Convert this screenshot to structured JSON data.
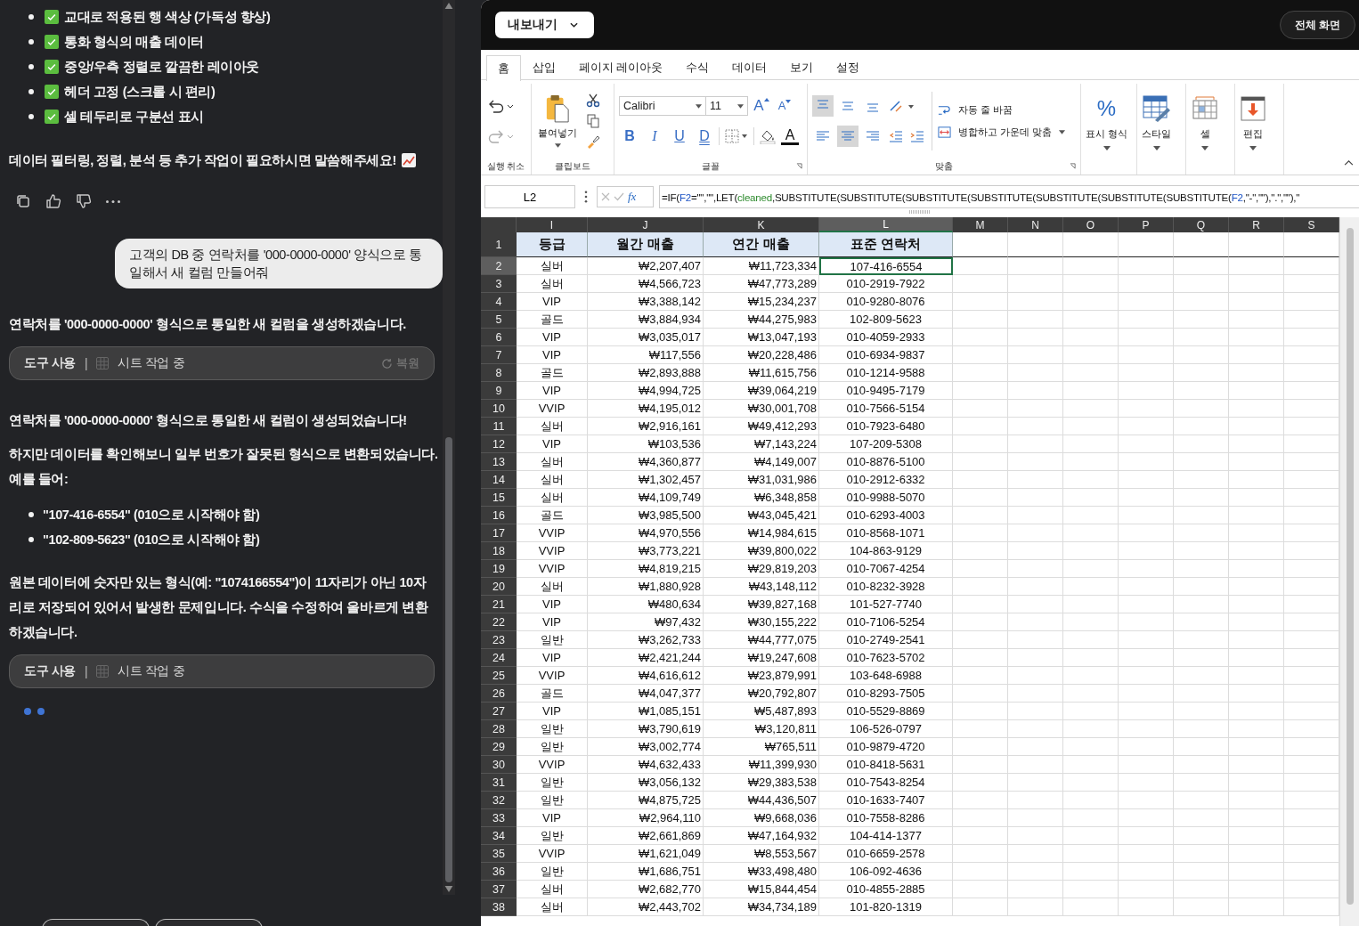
{
  "chat": {
    "checklist": [
      {
        "text": "교대로 적용된 행 색상 (가독성 향상)",
        "checked": true
      },
      {
        "text": "통화 형식의 매출 데이터",
        "checked": true
      },
      {
        "text": "중앙/우측 정렬로 깔끔한 레이아웃",
        "checked": true
      },
      {
        "text": "헤더 고정 (스크롤 시 편리)",
        "checked": true
      },
      {
        "text": "셀 테두리로 구분선 표시",
        "checked": true
      }
    ],
    "closing": "데이터 필터링, 정렬, 분석 등 추가 작업이 필요하시면 말씀해주세요!",
    "user_message": "고객의 DB 중 연락처를 '000-0000-0000' 양식으로 통일해서 새 컬럼 만들어줘",
    "blocks": [
      {
        "kind": "paragraph",
        "text": "연락처를 '000-0000-0000' 형식으로 통일한 새 컬럼을 생성하겠습니다."
      },
      {
        "kind": "tool",
        "label": "도구 사용",
        "separator": "|",
        "status": "시트 작업 중",
        "restore": "복원"
      },
      {
        "kind": "paragraph",
        "text": "연락처를 '000-0000-0000' 형식으로 통일한 새 컬럼이 생성되었습니다!"
      },
      {
        "kind": "paragraph",
        "text": "하지만 데이터를 확인해보니 일부 번호가 잘못된 형식으로 변환되었습니다. 예를 들어:"
      },
      {
        "kind": "bullets",
        "items": [
          "\"107-416-6554\" (010으로 시작해야 함)",
          "\"102-809-5623\" (010으로 시작해야 함)"
        ]
      },
      {
        "kind": "paragraph",
        "text": "원본 데이터에 숫자만 있는 형식(예: \"1074166554\")이 11자리가 아닌 10자리로 저장되어 있어서 발생한 문제입니다. 수식을 수정하여 올바르게 변환하겠습니다."
      },
      {
        "kind": "tool",
        "label": "도구 사용",
        "separator": "|",
        "status": "시트 작업 중"
      },
      {
        "kind": "loading"
      }
    ]
  },
  "topbar": {
    "export": "내보내기",
    "fullscreen": "전체 화면"
  },
  "ribbon": {
    "tabs": [
      {
        "label": "홈",
        "selected": true
      },
      {
        "label": "삽입",
        "selected": false
      },
      {
        "label": "페이지 레이아웃",
        "selected": false
      },
      {
        "label": "수식",
        "selected": false
      },
      {
        "label": "데이터",
        "selected": false
      },
      {
        "label": "보기",
        "selected": false
      },
      {
        "label": "설정",
        "selected": false
      }
    ],
    "groups": [
      {
        "kind": "undo",
        "label": "실행 취소"
      },
      {
        "kind": "clipboard",
        "label": "클립보드",
        "paste": "붙여넣기"
      },
      {
        "kind": "font",
        "label": "글꼴",
        "font": "Calibri",
        "size": "11",
        "grow": "A",
        "shrink": "A",
        "styles": [
          "B",
          "I",
          "U",
          "D"
        ],
        "font_color": "A"
      },
      {
        "kind": "alignment",
        "label": "맞춤",
        "vertical": [
          {
            "selected": true
          },
          {
            "selected": false
          },
          {
            "selected": false
          }
        ],
        "horizontal": [
          {
            "selected": false
          },
          {
            "selected": true
          },
          {
            "selected": false
          }
        ],
        "wrap": "자동 줄 바꿈",
        "merge": "병합하고 가운데 맞춤"
      },
      {
        "kind": "number_format",
        "label": "표시 형식",
        "glyph": "%"
      },
      {
        "kind": "styles",
        "label": "스타일"
      },
      {
        "kind": "cells",
        "label": "셀"
      },
      {
        "kind": "editing",
        "label": "편집"
      }
    ]
  },
  "formula_bar": {
    "name_box": "L2",
    "fx": "fx",
    "formula": [
      {
        "kind": "text",
        "text": "=IF("
      },
      {
        "kind": "ref",
        "text": "F2"
      },
      {
        "kind": "text",
        "text": "=\"\",\"\",LET("
      },
      {
        "kind": "name",
        "text": "cleaned"
      },
      {
        "kind": "text",
        "text": ",SUBSTITUTE(SUBSTITUTE(SUBSTITUTE(SUBSTITUTE(SUBSTITUTE(SUBSTITUTE(SUBSTITUTE("
      },
      {
        "kind": "ref",
        "text": "F2"
      },
      {
        "kind": "text",
        "text": ",\"-\",\"\"),\".\",\"\"),\""
      }
    ]
  },
  "sheet": {
    "columns": [
      {
        "letter": "I",
        "selected": false
      },
      {
        "letter": "J",
        "selected": false
      },
      {
        "letter": "K",
        "selected": false
      },
      {
        "letter": "L",
        "selected": true
      },
      {
        "letter": "M",
        "selected": false
      },
      {
        "letter": "N",
        "selected": false
      },
      {
        "letter": "O",
        "selected": false
      },
      {
        "letter": "P",
        "selected": false
      },
      {
        "letter": "Q",
        "selected": false
      },
      {
        "letter": "R",
        "selected": false
      },
      {
        "letter": "S",
        "selected": false
      }
    ],
    "header_row": {
      "number": "1",
      "cells": [
        "등급",
        "월간 매출",
        "연간 매출",
        "표준 연락처"
      ]
    },
    "rows": [
      {
        "number": "2",
        "selected": true,
        "cells": [
          "실버",
          "₩2,207,407",
          "₩11,723,334",
          "107-416-6554"
        ]
      },
      {
        "number": "3",
        "selected": false,
        "cells": [
          "실버",
          "₩4,566,723",
          "₩47,773,289",
          "010-2919-7922"
        ]
      },
      {
        "number": "4",
        "selected": false,
        "cells": [
          "VIP",
          "₩3,388,142",
          "₩15,234,237",
          "010-9280-8076"
        ]
      },
      {
        "number": "5",
        "selected": false,
        "cells": [
          "골드",
          "₩3,884,934",
          "₩44,275,983",
          "102-809-5623"
        ]
      },
      {
        "number": "6",
        "selected": false,
        "cells": [
          "VIP",
          "₩3,035,017",
          "₩13,047,193",
          "010-4059-2933"
        ]
      },
      {
        "number": "7",
        "selected": false,
        "cells": [
          "VIP",
          "₩117,556",
          "₩20,228,486",
          "010-6934-9837"
        ]
      },
      {
        "number": "8",
        "selected": false,
        "cells": [
          "골드",
          "₩2,893,888",
          "₩11,615,756",
          "010-1214-9588"
        ]
      },
      {
        "number": "9",
        "selected": false,
        "cells": [
          "VIP",
          "₩4,994,725",
          "₩39,064,219",
          "010-9495-7179"
        ]
      },
      {
        "number": "10",
        "selected": false,
        "cells": [
          "VVIP",
          "₩4,195,012",
          "₩30,001,708",
          "010-7566-5154"
        ]
      },
      {
        "number": "11",
        "selected": false,
        "cells": [
          "실버",
          "₩2,916,161",
          "₩49,412,293",
          "010-7923-6480"
        ]
      },
      {
        "number": "12",
        "selected": false,
        "cells": [
          "VIP",
          "₩103,536",
          "₩7,143,224",
          "107-209-5308"
        ]
      },
      {
        "number": "13",
        "selected": false,
        "cells": [
          "실버",
          "₩4,360,877",
          "₩4,149,007",
          "010-8876-5100"
        ]
      },
      {
        "number": "14",
        "selected": false,
        "cells": [
          "실버",
          "₩1,302,457",
          "₩31,031,986",
          "010-2912-6332"
        ]
      },
      {
        "number": "15",
        "selected": false,
        "cells": [
          "실버",
          "₩4,109,749",
          "₩6,348,858",
          "010-9988-5070"
        ]
      },
      {
        "number": "16",
        "selected": false,
        "cells": [
          "골드",
          "₩3,985,500",
          "₩43,045,421",
          "010-6293-4003"
        ]
      },
      {
        "number": "17",
        "selected": false,
        "cells": [
          "VVIP",
          "₩4,970,556",
          "₩14,984,615",
          "010-8568-1071"
        ]
      },
      {
        "number": "18",
        "selected": false,
        "cells": [
          "VVIP",
          "₩3,773,221",
          "₩39,800,022",
          "104-863-9129"
        ]
      },
      {
        "number": "19",
        "selected": false,
        "cells": [
          "VVIP",
          "₩4,819,215",
          "₩29,819,203",
          "010-7067-4254"
        ]
      },
      {
        "number": "20",
        "selected": false,
        "cells": [
          "실버",
          "₩1,880,928",
          "₩43,148,112",
          "010-8232-3928"
        ]
      },
      {
        "number": "21",
        "selected": false,
        "cells": [
          "VIP",
          "₩480,634",
          "₩39,827,168",
          "101-527-7740"
        ]
      },
      {
        "number": "22",
        "selected": false,
        "cells": [
          "VIP",
          "₩97,432",
          "₩30,155,222",
          "010-7106-5254"
        ]
      },
      {
        "number": "23",
        "selected": false,
        "cells": [
          "일반",
          "₩3,262,733",
          "₩44,777,075",
          "010-2749-2541"
        ]
      },
      {
        "number": "24",
        "selected": false,
        "cells": [
          "VIP",
          "₩2,421,244",
          "₩19,247,608",
          "010-7623-5702"
        ]
      },
      {
        "number": "25",
        "selected": false,
        "cells": [
          "VVIP",
          "₩4,616,612",
          "₩23,879,991",
          "103-648-6988"
        ]
      },
      {
        "number": "26",
        "selected": false,
        "cells": [
          "골드",
          "₩4,047,377",
          "₩20,792,807",
          "010-8293-7505"
        ]
      },
      {
        "number": "27",
        "selected": false,
        "cells": [
          "VIP",
          "₩1,085,151",
          "₩5,487,893",
          "010-5529-8869"
        ]
      },
      {
        "number": "28",
        "selected": false,
        "cells": [
          "일반",
          "₩3,790,619",
          "₩3,120,811",
          "106-526-0797"
        ]
      },
      {
        "number": "29",
        "selected": false,
        "cells": [
          "일반",
          "₩3,002,774",
          "₩765,511",
          "010-9879-4720"
        ]
      },
      {
        "number": "30",
        "selected": false,
        "cells": [
          "VVIP",
          "₩4,632,433",
          "₩11,399,930",
          "010-8418-5631"
        ]
      },
      {
        "number": "31",
        "selected": false,
        "cells": [
          "일반",
          "₩3,056,132",
          "₩29,383,538",
          "010-7543-8254"
        ]
      },
      {
        "number": "32",
        "selected": false,
        "cells": [
          "일반",
          "₩4,875,725",
          "₩44,436,507",
          "010-1633-7407"
        ]
      },
      {
        "number": "33",
        "selected": false,
        "cells": [
          "VIP",
          "₩2,964,110",
          "₩9,668,036",
          "010-7558-8286"
        ]
      },
      {
        "number": "34",
        "selected": false,
        "cells": [
          "일반",
          "₩2,661,869",
          "₩47,164,932",
          "104-414-1377"
        ]
      },
      {
        "number": "35",
        "selected": false,
        "cells": [
          "VVIP",
          "₩1,621,049",
          "₩8,553,567",
          "010-6659-2578"
        ]
      },
      {
        "number": "36",
        "selected": false,
        "cells": [
          "일반",
          "₩1,686,751",
          "₩33,498,480",
          "106-092-4636"
        ]
      },
      {
        "number": "37",
        "selected": false,
        "cells": [
          "실버",
          "₩2,682,770",
          "₩15,844,454",
          "010-4855-2885"
        ]
      },
      {
        "number": "38",
        "selected": false,
        "cells": [
          "실버",
          "₩2,443,702",
          "₩34,734,189",
          "101-820-1319"
        ]
      }
    ]
  }
}
